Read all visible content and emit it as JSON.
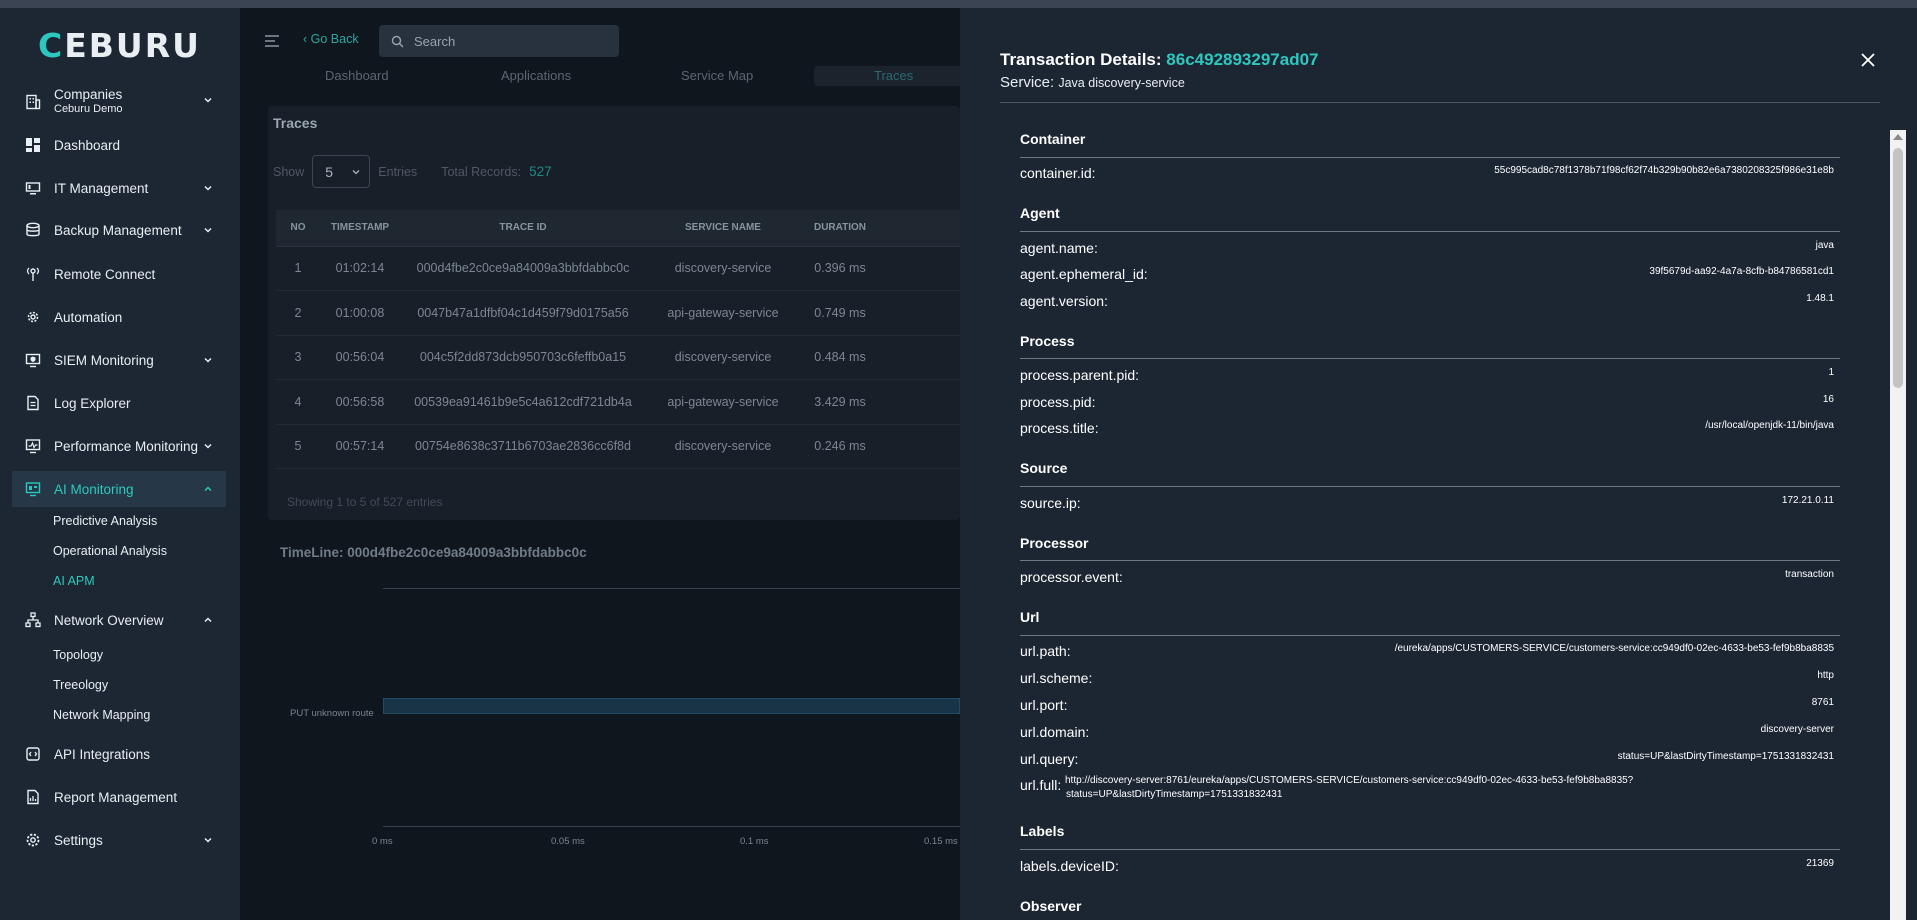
{
  "app": {
    "brand_main": "EBURU",
    "brand_accent": "C"
  },
  "sidebar": {
    "items": [
      {
        "label": "Companies",
        "sublabel": "Ceburu Demo"
      },
      {
        "label": "Dashboard"
      },
      {
        "label": "IT Management"
      },
      {
        "label": "Backup Management"
      },
      {
        "label": "Remote Connect"
      },
      {
        "label": "Automation"
      },
      {
        "label": "SIEM Monitoring"
      },
      {
        "label": "Log Explorer"
      },
      {
        "label": "Performance Monitoring"
      },
      {
        "label": "AI Monitoring"
      },
      {
        "label": "Network Overview"
      },
      {
        "label": "API Integrations"
      },
      {
        "label": "Report Management"
      },
      {
        "label": "Settings"
      }
    ],
    "ai_sub": [
      "Predictive Analysis",
      "Operational Analysis",
      "AI APM"
    ],
    "network_sub": [
      "Topology",
      "Treeology",
      "Network Mapping"
    ]
  },
  "header": {
    "go_back": "‹ Go Back",
    "search_placeholder": "Search"
  },
  "tabs": [
    "Dashboard",
    "Applications",
    "Service Map",
    "Traces"
  ],
  "traces": {
    "title": "Traces",
    "show_label": "Show",
    "entries_value": "5",
    "entries_label": "Entries",
    "total_label": "Total Records:",
    "total_value": "527",
    "columns": [
      "NO",
      "TIMESTAMP",
      "TRACE ID",
      "SERVICE NAME",
      "DURATION"
    ],
    "rows": [
      {
        "no": "1",
        "ts": "01:02:14",
        "id": "000d4fbe2c0ce9a84009a3bbfdabbc0c",
        "svc": "discovery-service",
        "dur": "0.396 ms"
      },
      {
        "no": "2",
        "ts": "01:00:08",
        "id": "0047b47a1dfbf04c1d459f79d0175a56",
        "svc": "api-gateway-service",
        "dur": "0.749 ms"
      },
      {
        "no": "3",
        "ts": "00:56:04",
        "id": "004c5f2dd873dcb950703c6feffb0a15",
        "svc": "discovery-service",
        "dur": "0.484 ms"
      },
      {
        "no": "4",
        "ts": "00:56:58",
        "id": "00539ea91461b9e5c4a612cdf721db4a",
        "svc": "api-gateway-service",
        "dur": "3.429 ms"
      },
      {
        "no": "5",
        "ts": "00:57:14",
        "id": "00754e8638c3711b6703ae2836cc6f8d",
        "svc": "discovery-service",
        "dur": "0.246 ms"
      }
    ],
    "showing": "Showing 1 to 5 of 527 entries"
  },
  "timeline": {
    "title": "TimeLine: 000d4fbe2c0ce9a84009a3bbfdabbc0c",
    "bar_label": "PUT unknown route",
    "ticks": [
      "0 ms",
      "0.05 ms",
      "0.1 ms",
      "0.15 ms"
    ]
  },
  "drawer": {
    "title_prefix": "Transaction Details:",
    "transaction_id": "86c492893297ad07",
    "service_label": "Service:",
    "service_value": "Java discovery-service",
    "sections": [
      {
        "name": "Container",
        "fields": [
          {
            "k": "container.id:",
            "v": "55c995cad8c78f1378b71f98cf62f74b329b90b82e6a7380208325f986e31e8b"
          }
        ]
      },
      {
        "name": "Agent",
        "fields": [
          {
            "k": "agent.name:",
            "v": "java"
          },
          {
            "k": "agent.ephemeral_id:",
            "v": "39f5679d-aa92-4a7a-8cfb-b84786581cd1"
          },
          {
            "k": "agent.version:",
            "v": "1.48.1"
          }
        ]
      },
      {
        "name": "Process",
        "fields": [
          {
            "k": "process.parent.pid:",
            "v": "1"
          },
          {
            "k": "process.pid:",
            "v": "16"
          },
          {
            "k": "process.title:",
            "v": "/usr/local/openjdk-11/bin/java"
          }
        ]
      },
      {
        "name": "Source",
        "fields": [
          {
            "k": "source.ip:",
            "v": "172.21.0.11"
          }
        ]
      },
      {
        "name": "Processor",
        "fields": [
          {
            "k": "processor.event:",
            "v": "transaction"
          }
        ]
      },
      {
        "name": "Url",
        "fields": [
          {
            "k": "url.path:",
            "v": "/eureka/apps/CUSTOMERS-SERVICE/customers-service:cc949df0-02ec-4633-be53-fef9b8ba8835"
          },
          {
            "k": "url.scheme:",
            "v": "http"
          },
          {
            "k": "url.port:",
            "v": "8761"
          },
          {
            "k": "url.domain:",
            "v": "discovery-server"
          },
          {
            "k": "url.query:",
            "v": "status=UP&lastDirtyTimestamp=1751331832431"
          },
          {
            "k": "url.full:",
            "v": "http://discovery-server:8761/eureka/apps/CUSTOMERS-SERVICE/customers-service:cc949df0-02ec-4633-be53-fef9b8ba8835?",
            "v2": "status=UP&lastDirtyTimestamp=1751331832431"
          }
        ]
      },
      {
        "name": "Labels",
        "fields": [
          {
            "k": "labels.deviceID:",
            "v": "21369"
          }
        ]
      },
      {
        "name": "Observer",
        "fields": []
      }
    ]
  },
  "colors": {
    "accent": "#2cc8bf",
    "sidebar_bg": "#1d2733",
    "drawer_bg": "#1c2633"
  }
}
